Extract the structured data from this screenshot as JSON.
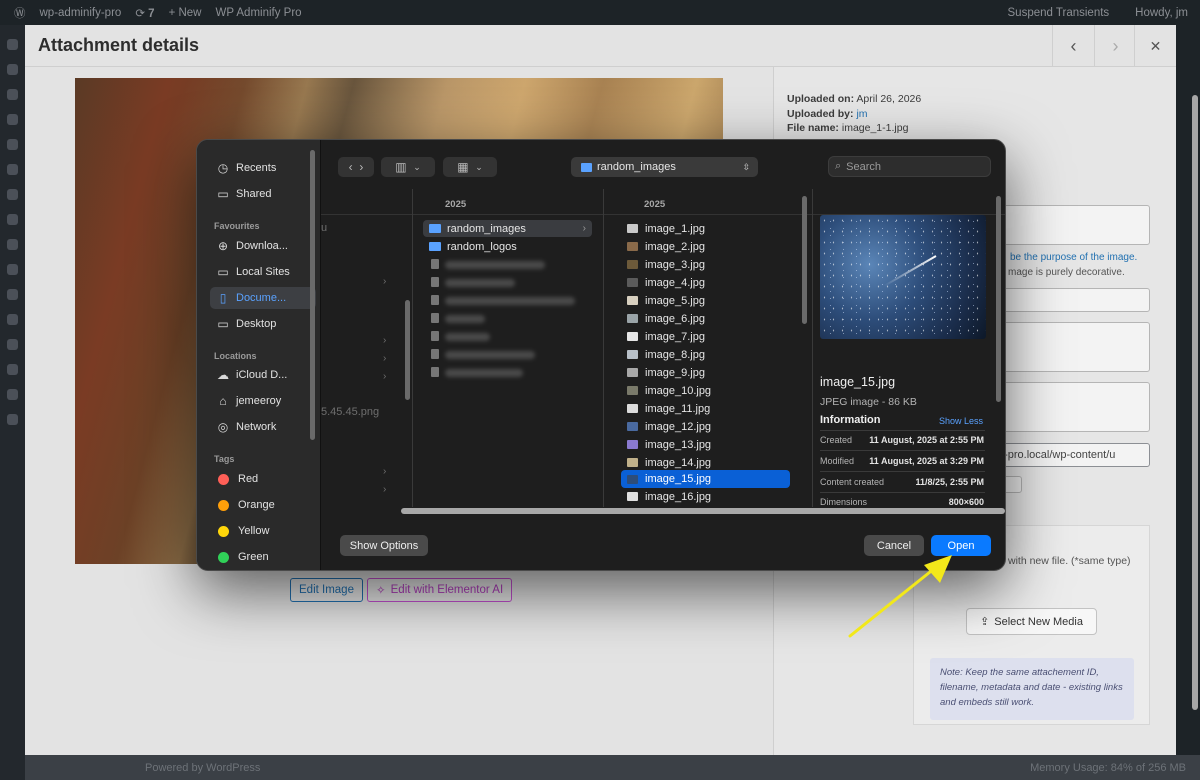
{
  "adminbar": {
    "site_name": "wp-adminify-pro",
    "updates": "7",
    "new": "New",
    "plugin": "WP Adminify Pro",
    "suspend": "Suspend Transients",
    "howdy": "Howdy, jm"
  },
  "footer": {
    "left": "Powered by WordPress",
    "right": "Memory Usage: 84% of 256 MB"
  },
  "modal": {
    "title": "Attachment details",
    "prev_icon": "‹",
    "next_icon": "›",
    "close_icon": "✕",
    "edit_image": "Edit Image",
    "edit_ai": "Edit with Elementor AI",
    "uploaded_on_label": "Uploaded on:",
    "uploaded_on": "April 26, 2026",
    "uploaded_by_label": "Uploaded by:",
    "uploaded_by": "jm",
    "file_name_label": "File name:",
    "file_name": "image_1-1.jpg",
    "alt_help_link": "be the purpose of the image.",
    "alt_help_text": "mage is purely decorative.",
    "file_url": "nify-pro.local/wp-content/u",
    "replace_text": "with new file. (*same type)",
    "select_new_media": "Select New Media",
    "note": "Note: Keep the same attachement ID, filename, metadata and date - existing links and embeds still work."
  },
  "dialog": {
    "sidebar": {
      "recents": "Recents",
      "shared": "Shared",
      "favourites_head": "Favourites",
      "downloads": "Downloa...",
      "local_sites": "Local Sites",
      "documents": "Docume...",
      "desktop": "Desktop",
      "locations_head": "Locations",
      "icloud": "iCloud D...",
      "jemeeroy": "jemeeroy",
      "network": "Network",
      "tags_head": "Tags",
      "tags": [
        {
          "label": "Red",
          "color": "#ff5f57"
        },
        {
          "label": "Orange",
          "color": "#ff9f0a"
        },
        {
          "label": "Yellow",
          "color": "#ffd60a"
        },
        {
          "label": "Green",
          "color": "#30d158"
        }
      ]
    },
    "path": "random_images",
    "search_placeholder": "Search",
    "col_year_1": "2025",
    "col_year_2": "2025",
    "ghost_1": "u",
    "ghost_2": "5.45.45.png",
    "folders": [
      "random_images",
      "random_logos"
    ],
    "files": [
      "image_1.jpg",
      "image_2.jpg",
      "image_3.jpg",
      "image_4.jpg",
      "image_5.jpg",
      "image_6.jpg",
      "image_7.jpg",
      "image_8.jpg",
      "image_9.jpg",
      "image_10.jpg",
      "image_11.jpg",
      "image_12.jpg",
      "image_13.jpg",
      "image_14.jpg",
      "image_15.jpg",
      "image_16.jpg"
    ],
    "selected_file": "image_15.jpg",
    "preview": {
      "name": "image_15.jpg",
      "type": "JPEG image - 86 KB",
      "info_label": "Information",
      "show_less": "Show Less",
      "created_label": "Created",
      "created": "11 August, 2025 at 2:55 PM",
      "modified_label": "Modified",
      "modified": "11 August, 2025 at 3:29 PM",
      "content_created_label": "Content created",
      "content_created": "11/8/25, 2:55 PM",
      "dimensions_label": "Dimensions",
      "dimensions": "800×600"
    },
    "show_options": "Show Options",
    "cancel": "Cancel",
    "open": "Open"
  },
  "colors": {
    "accent": "#0a7aff",
    "selection": "#0a60d6",
    "annotation_arrow": "#f2e81a"
  }
}
